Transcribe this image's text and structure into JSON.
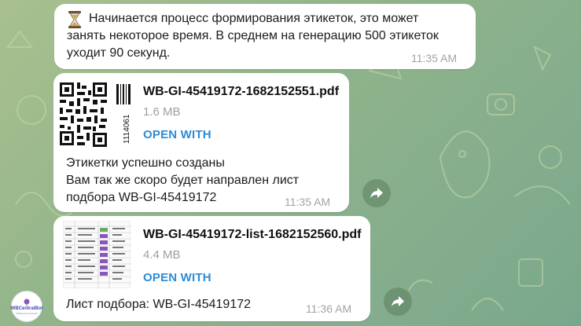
{
  "messages": [
    {
      "icon": "hourglass-icon",
      "text_lines": [
        "Начинается процесс формирования этикеток, это может",
        "занять некоторое время. В среднем на генерацию 500 этикеток",
        "уходит 90 секунд."
      ],
      "time": "11:35 AM"
    },
    {
      "file_name": "WB-GI-45419172-1682152551.pdf",
      "file_size": "1.6 MB",
      "open_label": "OPEN WITH",
      "thumb_code": "1114061",
      "caption_lines": [
        "Этикетки успешно созданы",
        "Вам так же скоро будет направлен лист",
        "подбора WB-GI-45419172"
      ],
      "time": "11:35 AM"
    },
    {
      "file_name": "WB-GI-45419172-list-1682152560.pdf",
      "file_size": "4.4 MB",
      "open_label": "OPEN WITH",
      "caption_lines": [
        "Лист подбора: WB-GI-45419172"
      ],
      "time": "11:36 AM"
    }
  ],
  "avatar": {
    "name": "WBCentralBot",
    "subtitle": "Wildberries Assistant"
  },
  "colors": {
    "accent": "#2b8bd6",
    "bubble": "#ffffff",
    "background": "#8fb38a",
    "time": "#a0a4a8"
  }
}
